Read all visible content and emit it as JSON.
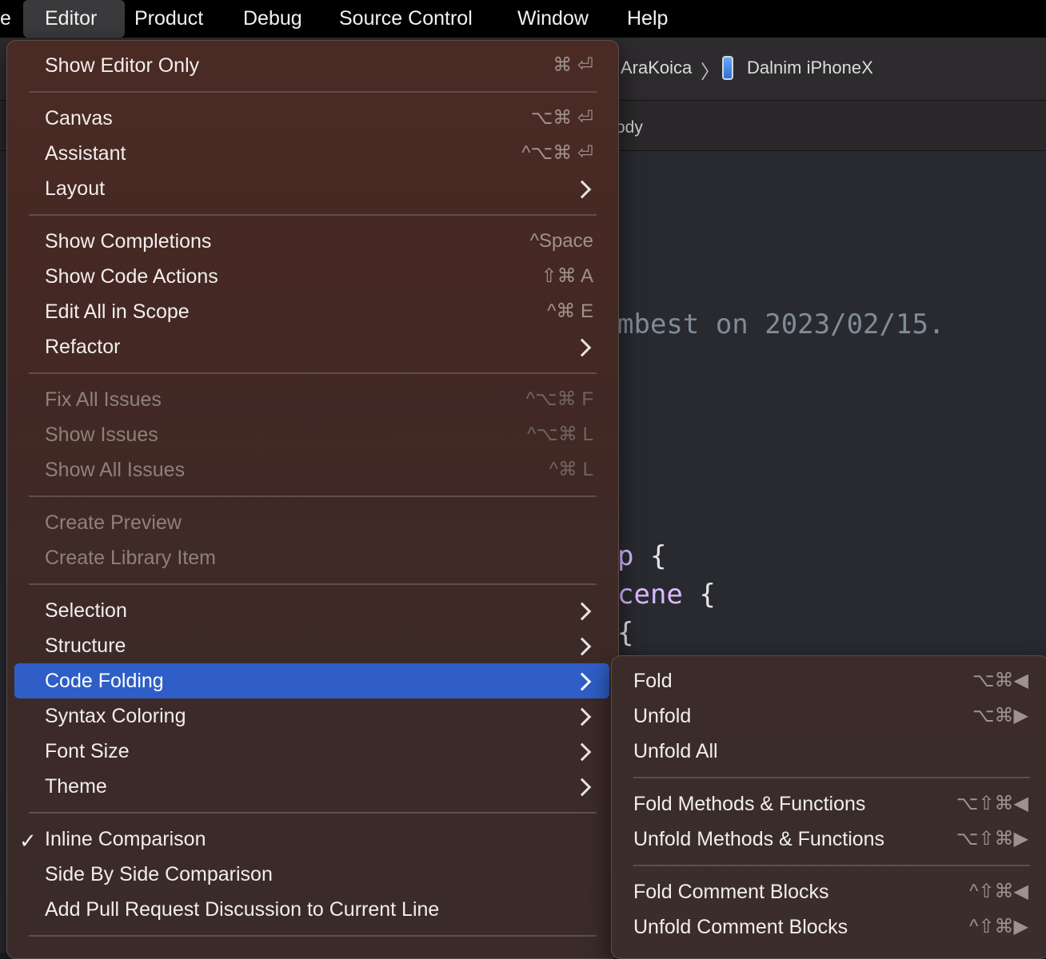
{
  "menubar": {
    "items": [
      "e",
      "Editor",
      "Product",
      "Debug",
      "Source Control",
      "Window",
      "Help"
    ],
    "active": "Editor"
  },
  "toolbar": {
    "scheme": "AraKoica",
    "separator": "〉",
    "device_icon": "iphone-icon",
    "device": "Dalnim iPhoneX"
  },
  "jumpbar": {
    "text": "ody"
  },
  "editor": {
    "comment": "mbest on 2023/02/15.",
    "line1_keyword": "p",
    "line1_brace": " {",
    "line2_keyword": "cene",
    "line2_brace": " {",
    "line3": "{"
  },
  "editor_menu": {
    "items": [
      {
        "label": "Show Editor Only",
        "shortcut": "⌘ ⏎",
        "enabled": true
      },
      {
        "label": "Canvas",
        "shortcut": "⌥⌘ ⏎",
        "enabled": true
      },
      {
        "label": "Assistant",
        "shortcut": "^⌥⌘ ⏎",
        "enabled": true
      },
      {
        "label": "Layout",
        "submenu": true,
        "enabled": true
      },
      {
        "label": "Show Completions",
        "shortcut": "^Space",
        "enabled": true
      },
      {
        "label": "Show Code Actions",
        "shortcut": "⇧⌘ A",
        "enabled": true
      },
      {
        "label": "Edit All in Scope",
        "shortcut": "^⌘ E",
        "enabled": true
      },
      {
        "label": "Refactor",
        "submenu": true,
        "enabled": true
      },
      {
        "label": "Fix All Issues",
        "shortcut": "^⌥⌘ F",
        "enabled": false
      },
      {
        "label": "Show Issues",
        "shortcut": "^⌥⌘ L",
        "enabled": false
      },
      {
        "label": "Show All Issues",
        "shortcut": "^⌘ L",
        "enabled": false
      },
      {
        "label": "Create Preview",
        "enabled": false
      },
      {
        "label": "Create Library Item",
        "enabled": false
      },
      {
        "label": "Selection",
        "submenu": true,
        "enabled": true
      },
      {
        "label": "Structure",
        "submenu": true,
        "enabled": true
      },
      {
        "label": "Code Folding",
        "submenu": true,
        "enabled": true,
        "highlighted": true
      },
      {
        "label": "Syntax Coloring",
        "submenu": true,
        "enabled": true
      },
      {
        "label": "Font Size",
        "submenu": true,
        "enabled": true
      },
      {
        "label": "Theme",
        "submenu": true,
        "enabled": true
      },
      {
        "label": "Inline Comparison",
        "checked": true,
        "enabled": true
      },
      {
        "label": "Side By Side Comparison",
        "enabled": true
      },
      {
        "label": "Add Pull Request Discussion to Current Line",
        "enabled": true
      }
    ],
    "check_mark": "✓"
  },
  "code_folding_menu": {
    "items": [
      {
        "label": "Fold",
        "shortcut": "⌥⌘◀"
      },
      {
        "label": "Unfold",
        "shortcut": "⌥⌘▶"
      },
      {
        "label": "Unfold All",
        "shortcut": ""
      },
      {
        "label": "Fold Methods & Functions",
        "shortcut": "⌥⇧⌘◀"
      },
      {
        "label": "Unfold Methods & Functions",
        "shortcut": "⌥⇧⌘▶"
      },
      {
        "label": "Fold Comment Blocks",
        "shortcut": "^⇧⌘◀"
      },
      {
        "label": "Unfold Comment Blocks",
        "shortcut": "^⇧⌘▶"
      }
    ]
  },
  "colors": {
    "highlight": "#2f5ec6",
    "menubar_bg": "#000000",
    "menu_bg": "#432823",
    "disabled_text": "#8e807c"
  }
}
